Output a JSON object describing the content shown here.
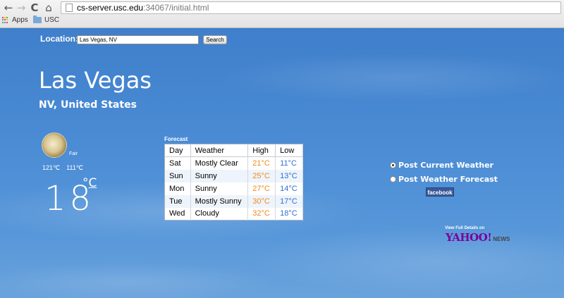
{
  "browser": {
    "back_icon": "←",
    "forward_icon": "→",
    "reload_icon": "C",
    "home_icon": "⌂",
    "url_host": "cs-server.usc.edu",
    "url_rest": ":34067/initial.html",
    "bookmarks": [
      {
        "label": "Apps",
        "icon": "apps-grid-icon"
      },
      {
        "label": "USC",
        "icon": "folder-icon"
      }
    ]
  },
  "search": {
    "label": "Location:",
    "value": "Las Vegas, NV",
    "button": "Search"
  },
  "location": {
    "city": "Las Vegas",
    "region": "NV, United States"
  },
  "current": {
    "condition": "Fair",
    "high": "121℃",
    "low": "111℃",
    "temp": "18",
    "degree": "°",
    "unit": "C"
  },
  "forecast": {
    "title": "Forecast",
    "headers": [
      "Day",
      "Weather",
      "High",
      "Low"
    ],
    "rows": [
      {
        "day": "Sat",
        "weather": "Mostly Clear",
        "high": "21°C",
        "low": "11°C"
      },
      {
        "day": "Sun",
        "weather": "Sunny",
        "high": "25°C",
        "low": "13°C"
      },
      {
        "day": "Mon",
        "weather": "Sunny",
        "high": "27°C",
        "low": "14°C"
      },
      {
        "day": "Tue",
        "weather": "Mostly Sunny",
        "high": "30°C",
        "low": "17°C"
      },
      {
        "day": "Wed",
        "weather": "Cloudy",
        "high": "32°C",
        "low": "18°C"
      }
    ],
    "colors": {
      "high": "#f08a17",
      "low": "#2f6fd0"
    }
  },
  "share": {
    "option_current": "Post Current Weather",
    "option_forecast": "Post Weather Forecast",
    "facebook_button": "facebook"
  },
  "credit": {
    "text": "View Full Details on",
    "logo_yahoo": "YAHOO!",
    "logo_news": "NEWS"
  }
}
